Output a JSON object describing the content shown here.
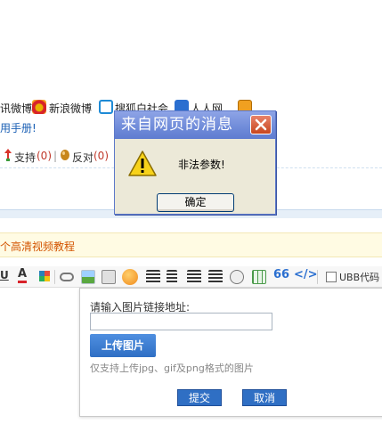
{
  "share": {
    "item1": "讯微博",
    "item2": "新浪微博",
    "item3": "搜狐白社会",
    "item4": "人人网"
  },
  "manual_link": "用手册!",
  "vote": {
    "support_label": "支持",
    "support_count": "(0)",
    "divider": "|",
    "oppose_label": "反对",
    "oppose_count": "(0)"
  },
  "tutorial_text": "个高清视频教程",
  "toolbar": {
    "ubb_label": "UBB代码"
  },
  "image_popup": {
    "url_label": "请输入图片链接地址:",
    "url_value": "",
    "upload_label": "上传图片",
    "support_note": "仅支持上传jpg、gif及png格式的图片",
    "submit_label": "提交",
    "cancel_label": "取消"
  },
  "alert_dialog": {
    "title": "来自网页的消息",
    "message": "非法参数!",
    "ok_label": "确定"
  },
  "colors": {
    "link_blue": "#1a5fb4",
    "tutorial_orange": "#d35400",
    "button_blue": "#2f6fc4",
    "dialog_title": "#6f8bd9"
  }
}
